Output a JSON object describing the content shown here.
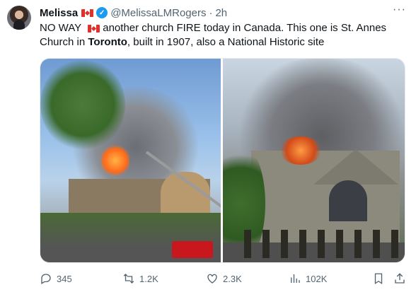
{
  "author": {
    "name": "Melissa",
    "handle": "@MelissaLMRogers",
    "separator": "·",
    "time": "2h",
    "flag_icon": "canada-flag-icon",
    "verified_icon": "verified-badge-icon"
  },
  "tweet": {
    "text_part1": "NO WAY",
    "text_part2": "another church FIRE today in Canada. This one is St. Annes Church in",
    "text_bold": "Toronto",
    "text_part3": ", built in 1907, also a National Historic site"
  },
  "media": {
    "photo_count": 2,
    "photos": [
      "church-fire-photo-left",
      "church-fire-photo-right"
    ]
  },
  "actions": {
    "replies": "345",
    "reposts": "1.2K",
    "likes": "2.3K",
    "views": "102K"
  },
  "colors": {
    "text": "#0f1419",
    "secondary": "#536471",
    "verified": "#1d9bf0"
  }
}
